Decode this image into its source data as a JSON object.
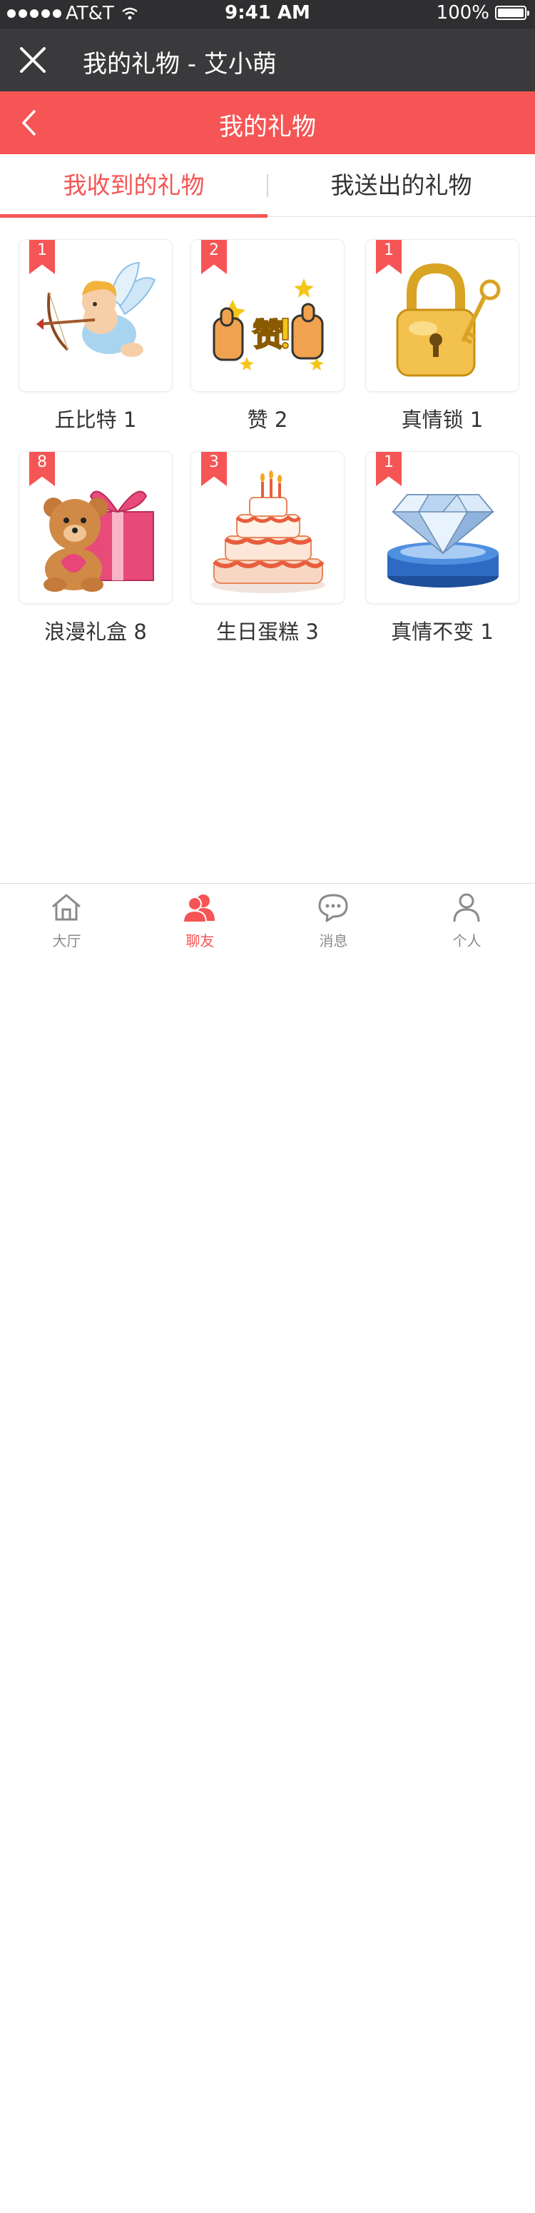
{
  "status_bar": {
    "carrier": "AT&T",
    "time": "9:41 AM",
    "battery": "100%"
  },
  "window": {
    "title": "我的礼物 - 艾小萌",
    "close_icon": "close-icon"
  },
  "header": {
    "title": "我的礼物",
    "back_icon": "chevron-left-icon",
    "color": "#f55554"
  },
  "tabs": [
    {
      "label": "我收到的礼物",
      "active": true
    },
    {
      "label": "我送出的礼物",
      "active": false
    }
  ],
  "gifts": [
    {
      "name": "丘比特",
      "count": "1",
      "label": "丘比特 1",
      "icon": "cupid-icon"
    },
    {
      "name": "赞",
      "count": "2",
      "label": "赞 2",
      "icon": "thumbs-up-icon"
    },
    {
      "name": "真情锁",
      "count": "1",
      "label": "真情锁 1",
      "icon": "padlock-key-icon"
    },
    {
      "name": "浪漫礼盒",
      "count": "8",
      "label": "浪漫礼盒 8",
      "icon": "teddy-giftbox-icon"
    },
    {
      "name": "生日蛋糕",
      "count": "3",
      "label": "生日蛋糕 3",
      "icon": "birthday-cake-icon"
    },
    {
      "name": "真情不变",
      "count": "1",
      "label": "真情不变 1",
      "icon": "diamond-icon"
    }
  ],
  "bottom_nav": [
    {
      "label": "大厅",
      "icon": "home-icon",
      "active": false
    },
    {
      "label": "聊友",
      "icon": "friends-icon",
      "active": true
    },
    {
      "label": "消息",
      "icon": "message-icon",
      "active": false
    },
    {
      "label": "个人",
      "icon": "person-icon",
      "active": false
    }
  ]
}
